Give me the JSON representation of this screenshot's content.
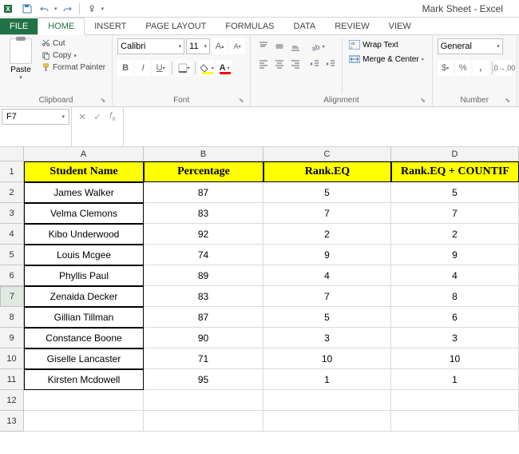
{
  "title": "Mark Sheet - Excel",
  "qat": {
    "save_icon": "save",
    "undo_icon": "undo",
    "redo_icon": "redo",
    "touch_icon": "touch"
  },
  "tabs": {
    "file": "FILE",
    "home": "HOME",
    "insert": "INSERT",
    "page_layout": "PAGE LAYOUT",
    "formulas": "FORMULAS",
    "data": "DATA",
    "review": "REVIEW",
    "view": "VIEW"
  },
  "ribbon": {
    "clipboard": {
      "paste_label": "Paste",
      "cut": "Cut",
      "copy": "Copy",
      "format_painter": "Format Painter",
      "label": "Clipboard"
    },
    "font": {
      "name": "Calibri",
      "size": "11",
      "label": "Font"
    },
    "alignment": {
      "wrap": "Wrap Text",
      "merge": "Merge & Center",
      "label": "Alignment"
    },
    "number": {
      "format": "General",
      "label": "Number"
    }
  },
  "formula_bar": {
    "name_box": "F7",
    "formula": ""
  },
  "columns": [
    "A",
    "B",
    "C",
    "D"
  ],
  "header_row": [
    "Student Name",
    "Percentage",
    "Rank.EQ",
    "Rank.EQ + COUNTIF"
  ],
  "rows": [
    {
      "name": "James Walker",
      "pct": "87",
      "rank": "5",
      "rank2": "5"
    },
    {
      "name": "Velma Clemons",
      "pct": "83",
      "rank": "7",
      "rank2": "7"
    },
    {
      "name": "Kibo Underwood",
      "pct": "92",
      "rank": "2",
      "rank2": "2"
    },
    {
      "name": "Louis Mcgee",
      "pct": "74",
      "rank": "9",
      "rank2": "9"
    },
    {
      "name": "Phyllis Paul",
      "pct": "89",
      "rank": "4",
      "rank2": "4"
    },
    {
      "name": "Zenaida Decker",
      "pct": "83",
      "rank": "7",
      "rank2": "8"
    },
    {
      "name": "Gillian Tillman",
      "pct": "87",
      "rank": "5",
      "rank2": "6"
    },
    {
      "name": "Constance Boone",
      "pct": "90",
      "rank": "3",
      "rank2": "3"
    },
    {
      "name": "Giselle Lancaster",
      "pct": "71",
      "rank": "10",
      "rank2": "10"
    },
    {
      "name": "Kirsten Mcdowell",
      "pct": "95",
      "rank": "1",
      "rank2": "1"
    }
  ],
  "active_cell": "F7",
  "active_row": 7
}
